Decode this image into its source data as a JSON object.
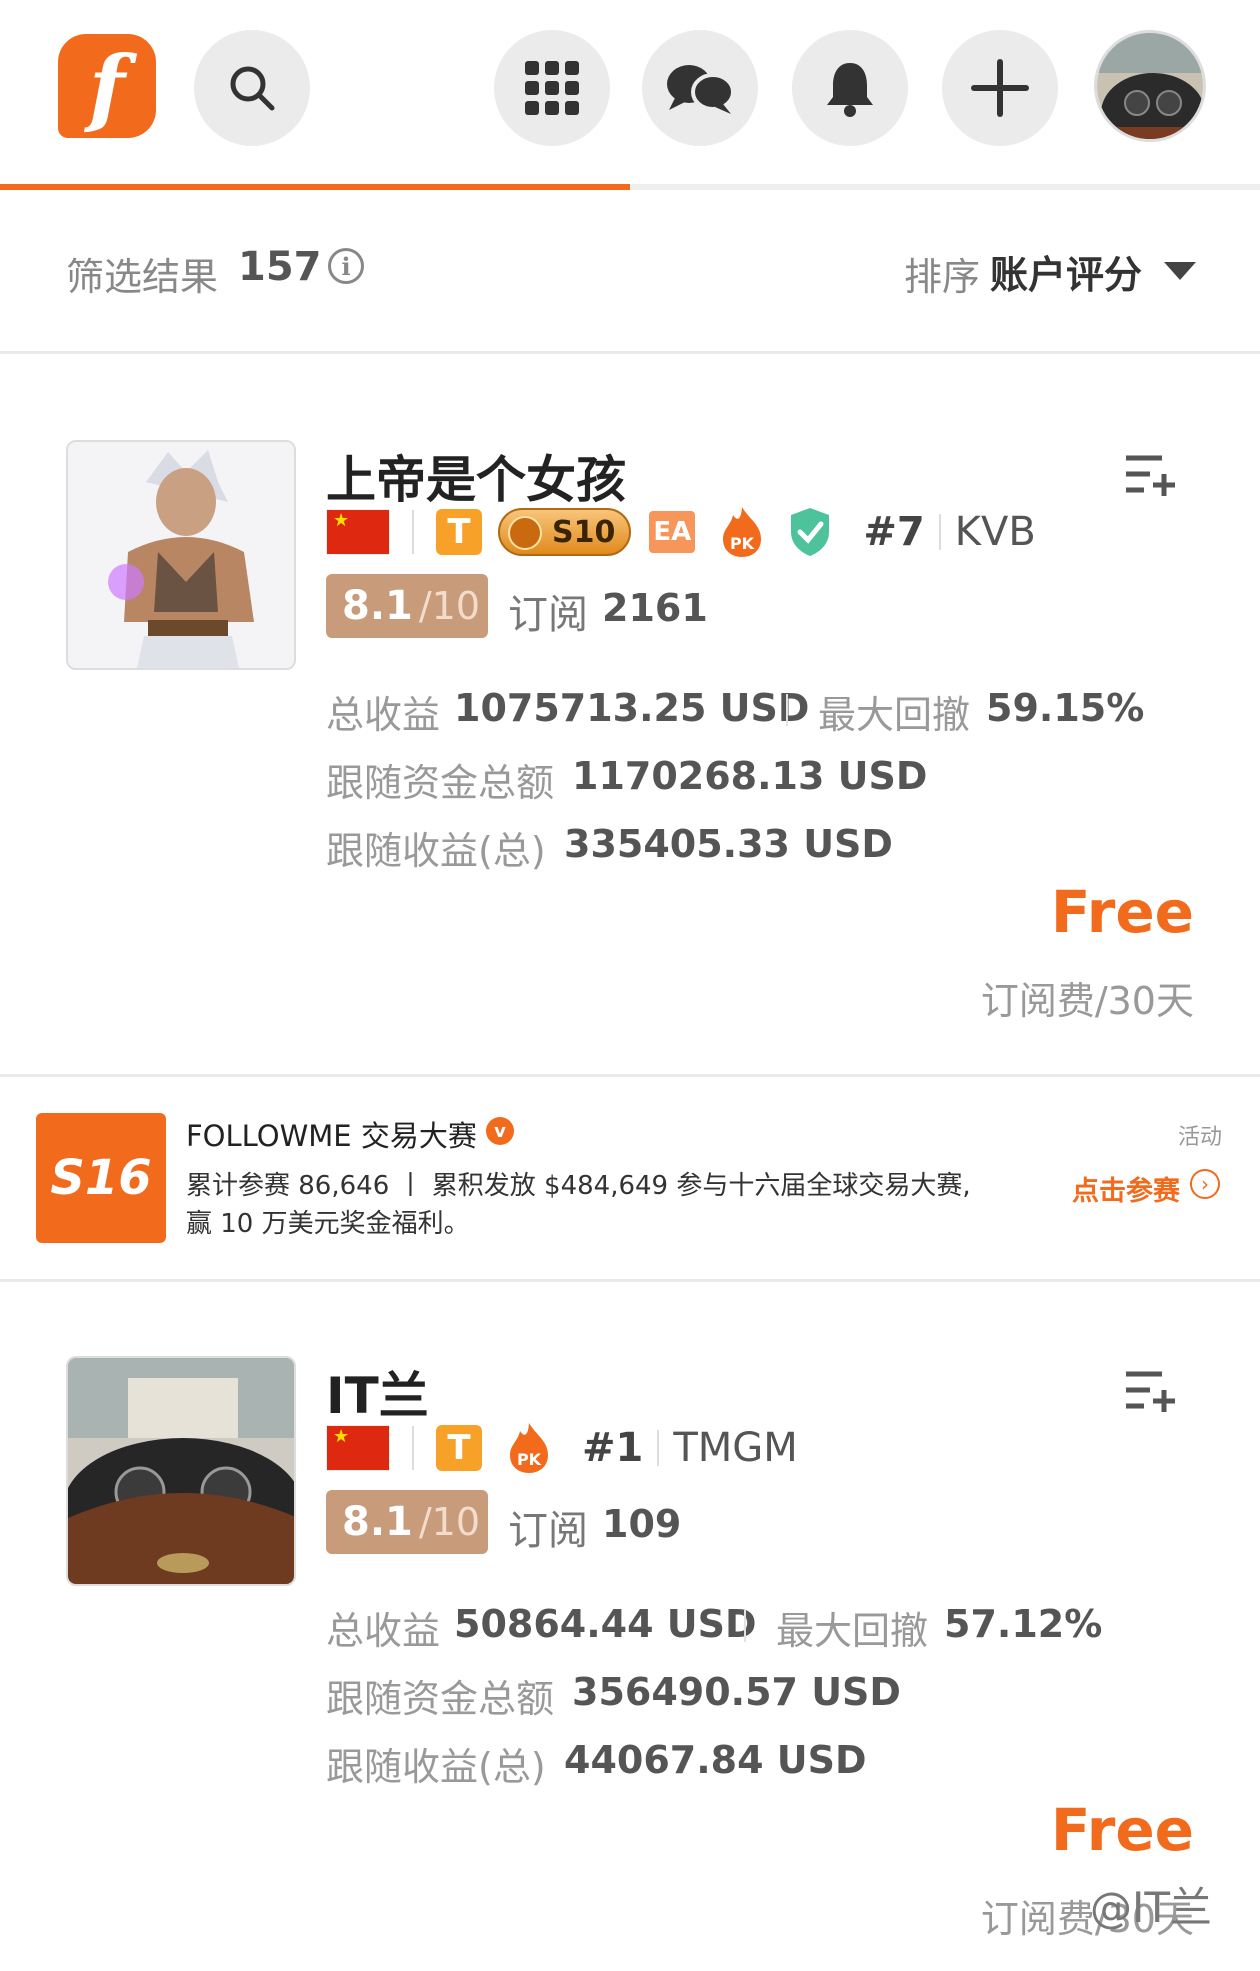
{
  "header": {
    "logo_glyph": "f",
    "icons": [
      "search-icon",
      "grid-icon",
      "chat-icon",
      "bell-icon",
      "plus-icon"
    ],
    "brand_color": "#f26b1d",
    "progress_fraction": 0.5
  },
  "filter": {
    "label": "筛选结果",
    "count": "157",
    "info_glyph": "i",
    "sort_label": "排序",
    "sort_value": "账户评分"
  },
  "traders": [
    {
      "name": "上帝是个女孩",
      "badges": [
        "cn-flag",
        "T",
        "S10",
        "EA",
        "PK",
        "verified-shield"
      ],
      "t_badge": "T",
      "s10_label": "S10",
      "ea_label": "EA",
      "pk_label": "PK",
      "rank": "#7",
      "broker": "KVB",
      "score": "8.1",
      "score_max": "/10",
      "sub_label": "订阅",
      "sub_count": "2161",
      "total_profit_label": "总收益",
      "total_profit": "1075713.25 USD",
      "max_drawdown_label": "最大回撤",
      "max_drawdown": "59.15%",
      "follow_funds_label": "跟随资金总额",
      "follow_funds": "1170268.13 USD",
      "follow_profit_label": "跟随收益(总)",
      "follow_profit": "335405.33 USD",
      "price": "Free",
      "price_unit": "订阅费/30天"
    },
    {
      "name": "IT兰",
      "badges": [
        "cn-flag",
        "T",
        "PK"
      ],
      "t_badge": "T",
      "pk_label": "PK",
      "rank": "#1",
      "broker": "TMGM",
      "score": "8.1",
      "score_max": "/10",
      "sub_label": "订阅",
      "sub_count": "109",
      "total_profit_label": "总收益",
      "total_profit": "50864.44 USD",
      "max_drawdown_label": "最大回撤",
      "max_drawdown": "57.12%",
      "follow_funds_label": "跟随资金总额",
      "follow_funds": "356490.57 USD",
      "follow_profit_label": "跟随收益(总)",
      "follow_profit": "44067.84 USD",
      "price": "Free",
      "price_unit": "订阅费/30天"
    }
  ],
  "promo": {
    "logo_text": "S16",
    "title": "FOLLOWME 交易大赛",
    "verified_glyph": "v",
    "line1": "累计参赛 86,646 丨 累积发放 $484,649 参与十六届全球交易大赛,",
    "line2": "赢 10 万美元奖金福利。",
    "tag": "活动",
    "cta": "点击参赛",
    "cta_glyph": "›"
  },
  "watermark": "@IT兰"
}
